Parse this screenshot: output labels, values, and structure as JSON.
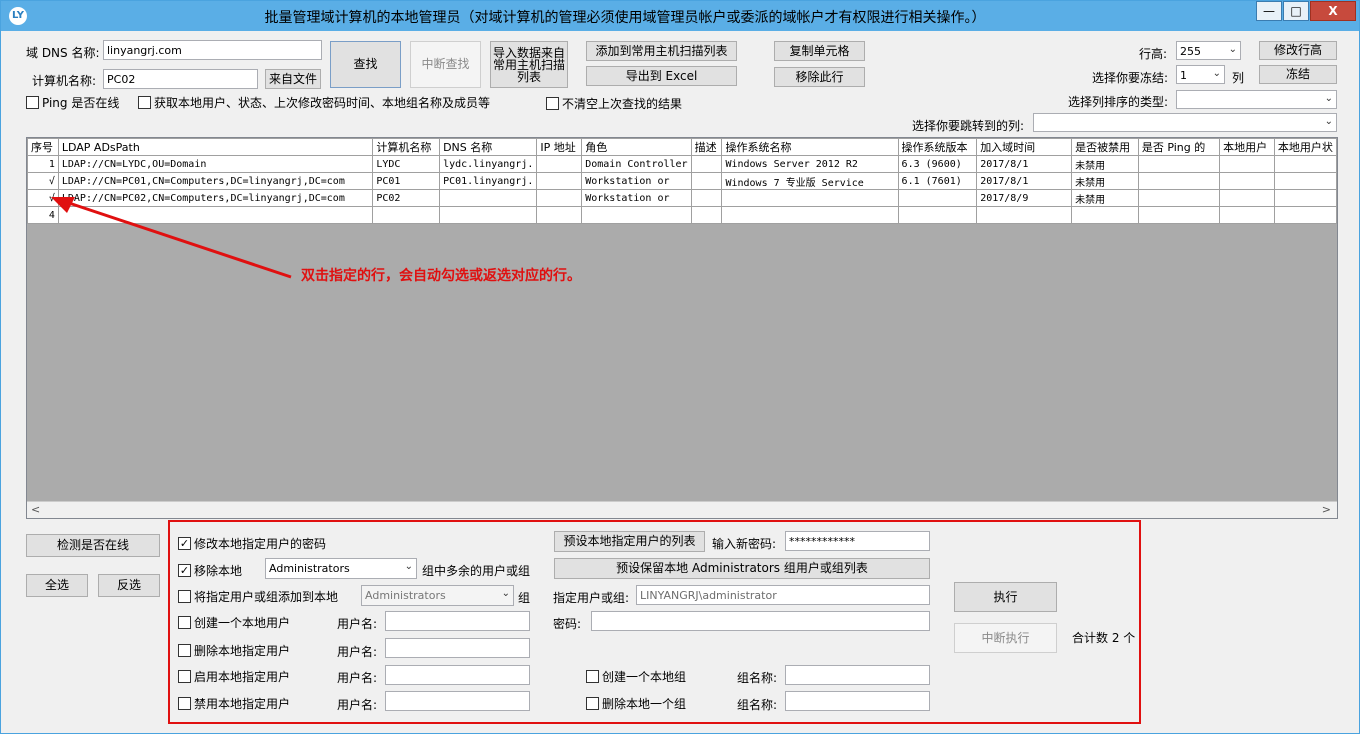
{
  "window": {
    "title": "批量管理域计算机的本地管理员（对域计算机的管理必须使用域管理员帐户或委派的域帐户才有权限进行相关操作。）",
    "min_label": "—",
    "max_label": "□",
    "close_label": "X",
    "app_icon_text": "LY"
  },
  "top": {
    "dns_label": "域 DNS 名称:",
    "dns_value": "linyangrj.com",
    "computer_label": "计算机名称:",
    "computer_value": "PC02",
    "from_file_btn": "来自文件",
    "find_btn": "查找",
    "stop_find_btn": "中断查找",
    "import_btn": "导入数据来自常用主机扫描列表",
    "add_scan_btn": "添加到常用主机扫描列表",
    "copy_cell_btn": "复制单元格",
    "export_btn": "导出到 Excel",
    "remove_row_btn": "移除此行",
    "ping_cb": "Ping 是否在线",
    "get_info_cb": "获取本地用户、状态、上次修改密码时间、本地组名称及成员等",
    "no_clear_cb": "不清空上次查找的结果",
    "row_height_label": "行高:",
    "row_height_value": "255",
    "modify_row_btn": "修改行高",
    "freeze_label": "选择你要冻结:",
    "freeze_value": "1",
    "freeze_unit": "列",
    "freeze_btn": "冻结",
    "sort_label": "选择列排序的类型:",
    "sort_value": "",
    "jump_label": "选择你要跳转到的列:",
    "jump_value": ""
  },
  "grid": {
    "columns": [
      "序号",
      "LDAP ADsPath",
      "计算机名称",
      "DNS 名称",
      "IP 地址",
      "角色",
      "描述",
      "操作系统名称",
      "操作系统版本",
      "加入域时间",
      "是否被禁用",
      "是否 Ping 的",
      "本地用户",
      "本地用户状"
    ],
    "rows": [
      [
        "1",
        "LDAP://CN=LYDC,OU=Domain",
        "LYDC",
        "lydc.linyangrj.",
        "",
        "Domain Controller",
        "",
        "Windows Server 2012 R2",
        "6.3 (9600)",
        "2017/8/1",
        "未禁用",
        "",
        "",
        ""
      ],
      [
        "√",
        "LDAP://CN=PC01,CN=Computers,DC=linyangrj,DC=com",
        "PC01",
        "PC01.linyangrj.",
        "",
        "Workstation or",
        "",
        "Windows 7 专业版 Service",
        "6.1 (7601)",
        "2017/8/1",
        "未禁用",
        "",
        "",
        ""
      ],
      [
        "√",
        "LDAP://CN=PC02,CN=Computers,DC=linyangrj,DC=com",
        "PC02",
        "",
        "",
        "Workstation or",
        "",
        "",
        "",
        "2017/8/9",
        "未禁用",
        "",
        "",
        ""
      ],
      [
        "4",
        "",
        "",
        "",
        "",
        "",
        "",
        "",
        "",
        "",
        "",
        "",
        "",
        ""
      ]
    ],
    "scroll_left": "<",
    "scroll_right": ">"
  },
  "annotation": "双击指定的行，会自动勾选或返选对应的行。",
  "bottom": {
    "check_online_btn": "检测是否在线",
    "select_all_btn": "全选",
    "invert_btn": "反选",
    "change_pwd_cb": "修改本地指定用户的密码",
    "remove_local_cb": "移除本地",
    "remove_group_value": "Administrators",
    "remove_suffix": "组中多余的用户或组",
    "add_to_local_cb": "将指定用户或组添加到本地",
    "add_group_value": "Administrators",
    "add_suffix": "组",
    "create_user_cb": "创建一个本地用户",
    "delete_user_cb": "删除本地指定用户",
    "enable_user_cb": "启用本地指定用户",
    "disable_user_cb": "禁用本地指定用户",
    "username_label": "用户名:",
    "preset_users_btn": "预设本地指定用户的列表",
    "new_pwd_label": "输入新密码:",
    "new_pwd_value": "************",
    "preset_admins_btn": "预设保留本地 Administrators 组用户或组列表",
    "specified_label": "指定用户或组:",
    "specified_value": "LINYANGRJ\\administrator",
    "pwd_label": "密码:",
    "create_group_cb": "创建一个本地组",
    "delete_group_cb": "删除本地一个组",
    "group_name_label": "组名称:",
    "execute_btn": "执行",
    "stop_execute_btn": "中断执行",
    "total_label": "合计数 2 个"
  }
}
